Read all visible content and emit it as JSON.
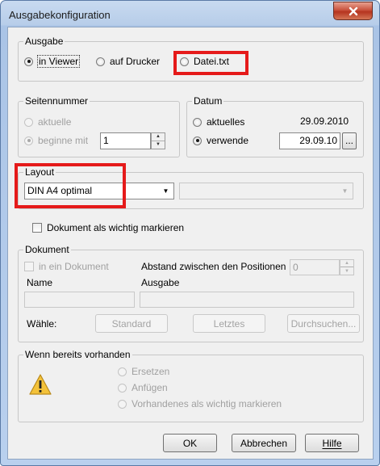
{
  "window": {
    "title": "Ausgabekonfiguration"
  },
  "ausgabe": {
    "legend": "Ausgabe",
    "opt_viewer": "in Viewer",
    "opt_drucker": "auf Drucker",
    "opt_datei": "Datei.txt"
  },
  "seitennummer": {
    "legend": "Seitennummer",
    "opt_aktuelle": "aktuelle",
    "opt_beginne": "beginne mit",
    "value": "1"
  },
  "datum": {
    "legend": "Datum",
    "opt_aktuelles": "aktuelles",
    "aktuelles_value": "29.09.2010",
    "opt_verwende": "verwende",
    "verwende_value": "29.09.10",
    "browse": "..."
  },
  "layout": {
    "legend": "Layout",
    "selected": "DIN A4 optimal",
    "second_selected": ""
  },
  "wichtig": {
    "label": "Dokument als wichtig markieren"
  },
  "dokument": {
    "legend": "Dokument",
    "in_ein": "in ein Dokument",
    "abstand_label": "Abstand zwischen den Positionen",
    "abstand_value": "0",
    "name_label": "Name",
    "ausgabe_label": "Ausgabe",
    "waehle_label": "Wähle:",
    "btn_standard": "Standard",
    "btn_letztes": "Letztes",
    "btn_durchsuchen": "Durchsuchen..."
  },
  "vorhanden": {
    "legend": "Wenn bereits vorhanden",
    "opt_ersetzen": "Ersetzen",
    "opt_anfuegen": "Anfügen",
    "opt_wichtig": "Vorhandenes als wichtig markieren"
  },
  "footer": {
    "ok": "OK",
    "abbrechen": "Abbrechen",
    "hilfe": "Hilfe"
  }
}
